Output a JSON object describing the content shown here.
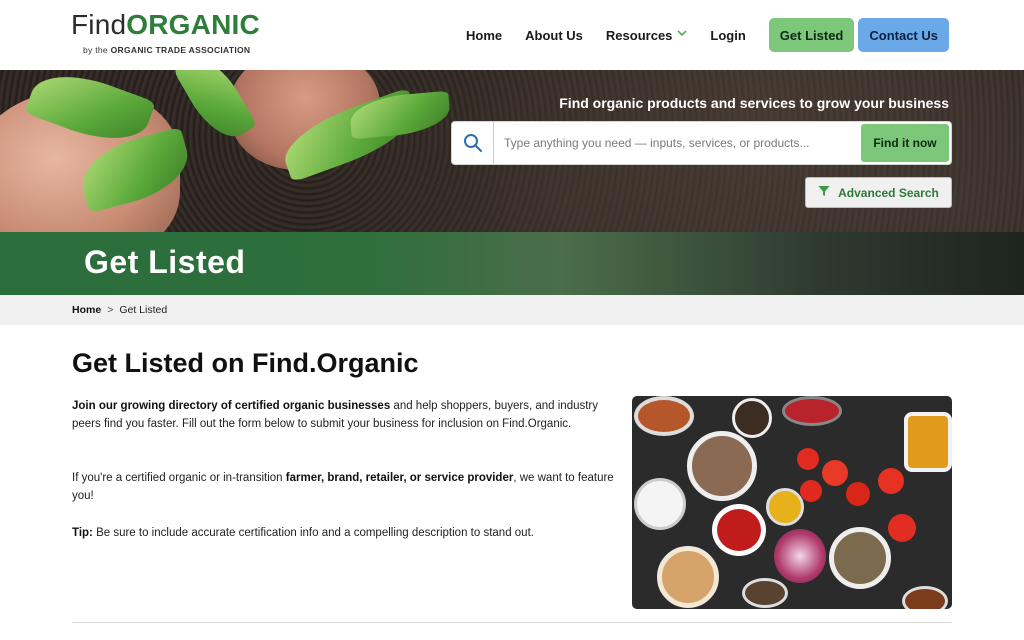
{
  "header": {
    "logo_find": "Find",
    "logo_organic": "ORGANIC",
    "logo_by": "by the",
    "logo_association": "ORGANIC TRADE ASSOCIATION",
    "nav": {
      "home": "Home",
      "about": "About Us",
      "resources": "Resources",
      "login": "Login",
      "get_listed": "Get Listed",
      "contact": "Contact Us"
    }
  },
  "hero": {
    "tagline": "Find organic products and services to grow your business",
    "search_placeholder": "Type anything you need — inputs, services, or products...",
    "search_value": "",
    "search_button": "Find it now",
    "advanced_search": "Advanced Search"
  },
  "page": {
    "title": "Get Listed"
  },
  "breadcrumb": {
    "home": "Home",
    "separator": ">",
    "current": "Get Listed"
  },
  "content": {
    "heading": "Get Listed on Find.Organic",
    "p1_bold": "Join our growing directory of certified organic businesses",
    "p1_rest": " and help shoppers, buyers, and industry peers find you faster. Fill out the form below to submit your business for inclusion on Find.Organic.",
    "p2_pre": "If you're a certified organic or in-transition ",
    "p2_bold": "farmer, brand, retailer, or service provider",
    "p2_post": ", we want to feature you!",
    "p3_bold": "Tip:",
    "p3_rest": " Be sure to include accurate certification info and a compelling description to stand out."
  },
  "colors": {
    "brand_green": "#2e7d3a",
    "button_green": "#7cc77a",
    "button_blue": "#6aa8e8"
  },
  "icons": {
    "search": "search-icon",
    "filter": "filter-icon",
    "chevron": "chevron-down-icon"
  }
}
